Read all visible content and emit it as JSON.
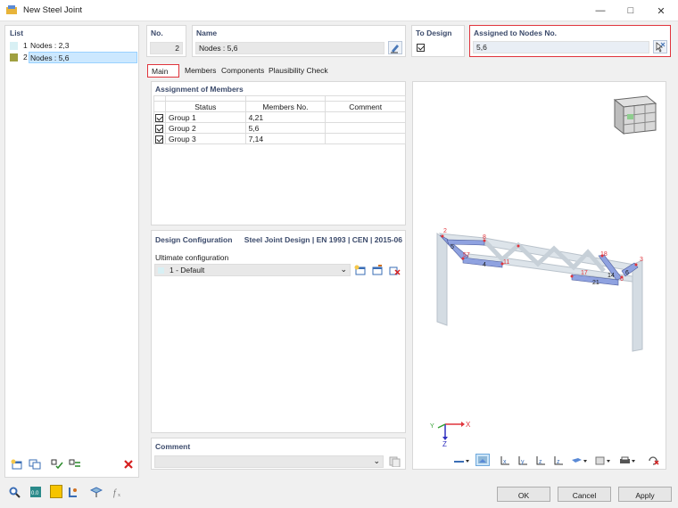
{
  "window": {
    "title": "New Steel Joint"
  },
  "list": {
    "header": "List",
    "items": [
      {
        "no": "1",
        "label": "Nodes : 2,3",
        "color": "#d8f0f4"
      },
      {
        "no": "2",
        "label": "Nodes : 5,6",
        "color": "#a0a040"
      }
    ]
  },
  "fields": {
    "no_label": "No.",
    "no_value": "2",
    "name_label": "Name",
    "name_value": "Nodes : 5,6",
    "to_design_label": "To Design",
    "assigned_label": "Assigned to Nodes No.",
    "assigned_value": "5,6"
  },
  "tabs": [
    "Main",
    "Members",
    "Components",
    "Plausibility Check"
  ],
  "assignment": {
    "header": "Assignment of Members",
    "columns": [
      "Status",
      "Members No.",
      "Comment"
    ],
    "rows": [
      {
        "status": "Group 1",
        "members": "4,21",
        "comment": ""
      },
      {
        "status": "Group 2",
        "members": "5,6",
        "comment": ""
      },
      {
        "status": "Group 3",
        "members": "7,14",
        "comment": ""
      }
    ]
  },
  "design": {
    "header": "Design Configuration",
    "standard": "Steel Joint Design | EN 1993 | CEN | 2015-06",
    "ult_label": "Ultimate configuration",
    "ult_value": "1 - Default"
  },
  "comment": {
    "header": "Comment",
    "value": ""
  },
  "model_labels": {
    "n2": "2",
    "n8": "8",
    "n5": "5",
    "n57": "57",
    "n4": "4",
    "n11": "11",
    "n17": "17",
    "n18": "18",
    "n14": "14",
    "n21": "21",
    "n6": "6",
    "n6b": "6",
    "n3": "3"
  },
  "axes": {
    "x": "X",
    "y": "Y",
    "z": "Z"
  },
  "buttons": {
    "ok": "OK",
    "cancel": "Cancel",
    "apply": "Apply"
  },
  "colors": {
    "accent": "#e0343c",
    "header_text": "#3b4a6b",
    "selected_row": "#cce8ff",
    "member": "#8fa2e0"
  }
}
